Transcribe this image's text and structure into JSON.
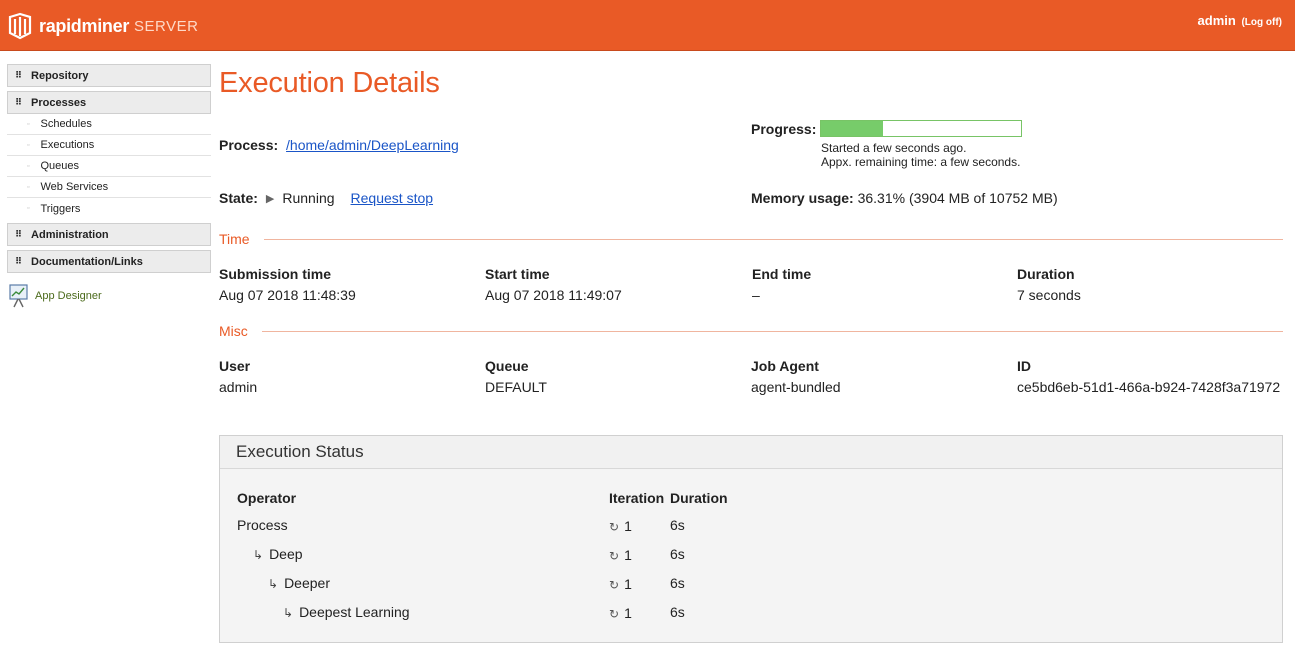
{
  "header": {
    "brand": "rapidminer",
    "product": "SERVER",
    "user": "admin",
    "logoff": "(Log off)"
  },
  "sidebar": {
    "groups": [
      {
        "label": "Repository"
      },
      {
        "label": "Processes",
        "items": [
          "Schedules",
          "Executions",
          "Queues",
          "Web Services",
          "Triggers"
        ]
      },
      {
        "label": "Administration"
      },
      {
        "label": "Documentation/Links"
      }
    ],
    "app_designer": "App Designer"
  },
  "page": {
    "title": "Execution Details",
    "process_label": "Process:",
    "process_path": "/home/admin/DeepLearning",
    "state_label": "State:",
    "state_value": "Running",
    "request_stop": "Request stop",
    "progress_label": "Progress:",
    "progress_fraction": 0.31,
    "progress_started": "Started a few seconds ago.",
    "progress_remaining": "Appx. remaining time: a few seconds.",
    "memory_label": "Memory usage:",
    "memory_value": "36.31% (3904 MB of 10752 MB)"
  },
  "time_section": {
    "title": "Time",
    "fields": [
      {
        "label": "Submission time",
        "value": "Aug 07 2018 11:48:39"
      },
      {
        "label": "Start time",
        "value": "Aug 07 2018 11:49:07"
      },
      {
        "label": "End time",
        "value": "–"
      },
      {
        "label": "Duration",
        "value": "7 seconds"
      }
    ]
  },
  "misc_section": {
    "title": "Misc",
    "fields": [
      {
        "label": "User",
        "value": "admin"
      },
      {
        "label": "Queue",
        "value": "DEFAULT"
      },
      {
        "label": "Job Agent",
        "value": "agent-bundled"
      },
      {
        "label": "ID",
        "value": "ce5bd6eb-51d1-466a-b924-7428f3a71972"
      }
    ]
  },
  "exec_status": {
    "title": "Execution Status",
    "columns": [
      "Operator",
      "Iteration",
      "Duration"
    ],
    "rows": [
      {
        "operator": "Process",
        "iteration": "1",
        "duration": "6s"
      },
      {
        "operator": "Deep",
        "iteration": "1",
        "duration": "6s"
      },
      {
        "operator": "Deeper",
        "iteration": "1",
        "duration": "6s"
      },
      {
        "operator": "Deepest Learning",
        "iteration": "1",
        "duration": "6s"
      }
    ]
  },
  "colors": {
    "accent": "#e95a26",
    "link": "#1a55c7",
    "progress": "#77cc6a"
  }
}
